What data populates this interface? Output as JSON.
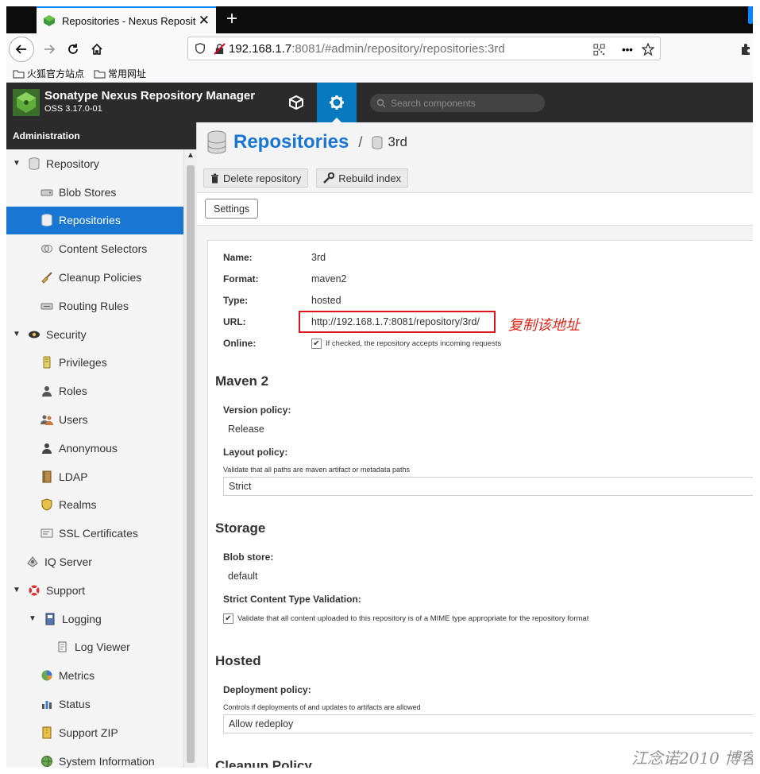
{
  "browser": {
    "tab_title": "Repositories - Nexus Reposit",
    "close_glyph": "✕",
    "new_tab_glyph": "+",
    "url_host": "192.168.1.7",
    "url_rest": ":8081/#admin/repository/repositories:3rd",
    "more_glyph": "•••",
    "bookmarks": [
      "火狐官方站点",
      "常用网址"
    ]
  },
  "nexus": {
    "brand_name": "Sonatype Nexus Repository Manager",
    "version": "OSS 3.17.0-01",
    "search_placeholder": "Search components"
  },
  "sidebar": {
    "title": "Administration",
    "items": [
      {
        "label": "Repository"
      },
      {
        "label": "Blob Stores"
      },
      {
        "label": "Repositories"
      },
      {
        "label": "Content Selectors"
      },
      {
        "label": "Cleanup Policies"
      },
      {
        "label": "Routing Rules"
      },
      {
        "label": "Security"
      },
      {
        "label": "Privileges"
      },
      {
        "label": "Roles"
      },
      {
        "label": "Users"
      },
      {
        "label": "Anonymous"
      },
      {
        "label": "LDAP"
      },
      {
        "label": "Realms"
      },
      {
        "label": "SSL Certificates"
      },
      {
        "label": "IQ Server"
      },
      {
        "label": "Support"
      },
      {
        "label": "Logging"
      },
      {
        "label": "Log Viewer"
      },
      {
        "label": "Metrics"
      },
      {
        "label": "Status"
      },
      {
        "label": "Support ZIP"
      },
      {
        "label": "System Information"
      }
    ]
  },
  "main": {
    "title": "Repositories",
    "separator": "/",
    "repo_name": "3rd",
    "toolbar": {
      "delete_label": "Delete repository",
      "rebuild_label": "Rebuild index"
    },
    "tab_settings": "Settings",
    "summary": {
      "name_label": "Name:",
      "name_value": "3rd",
      "format_label": "Format:",
      "format_value": "maven2",
      "type_label": "Type:",
      "type_value": "hosted",
      "url_label": "URL:",
      "url_value": "http://192.168.1.7:8081/repository/3rd/",
      "online_label": "Online:",
      "online_help": "If checked, the repository accepts incoming requests"
    },
    "annotation": "复制该地址",
    "maven": {
      "heading": "Maven 2",
      "version_policy_label": "Version policy:",
      "version_policy_value": "Release",
      "layout_policy_label": "Layout policy:",
      "layout_policy_help": "Validate that all paths are maven artifact or metadata paths",
      "layout_policy_value": "Strict"
    },
    "storage": {
      "heading": "Storage",
      "blob_store_label": "Blob store:",
      "blob_store_value": "default",
      "strict_label": "Strict Content Type Validation:",
      "strict_help": "Validate that all content uploaded to this repository is of a MIME type appropriate for the repository format"
    },
    "hosted": {
      "heading": "Hosted",
      "deployment_label": "Deployment policy:",
      "deployment_help": "Controls if deployments of and updates to artifacts are allowed",
      "deployment_value": "Allow redeploy"
    },
    "cleanup": {
      "heading": "Cleanup Policy"
    }
  },
  "watermark": "江念诺2010 博客"
}
